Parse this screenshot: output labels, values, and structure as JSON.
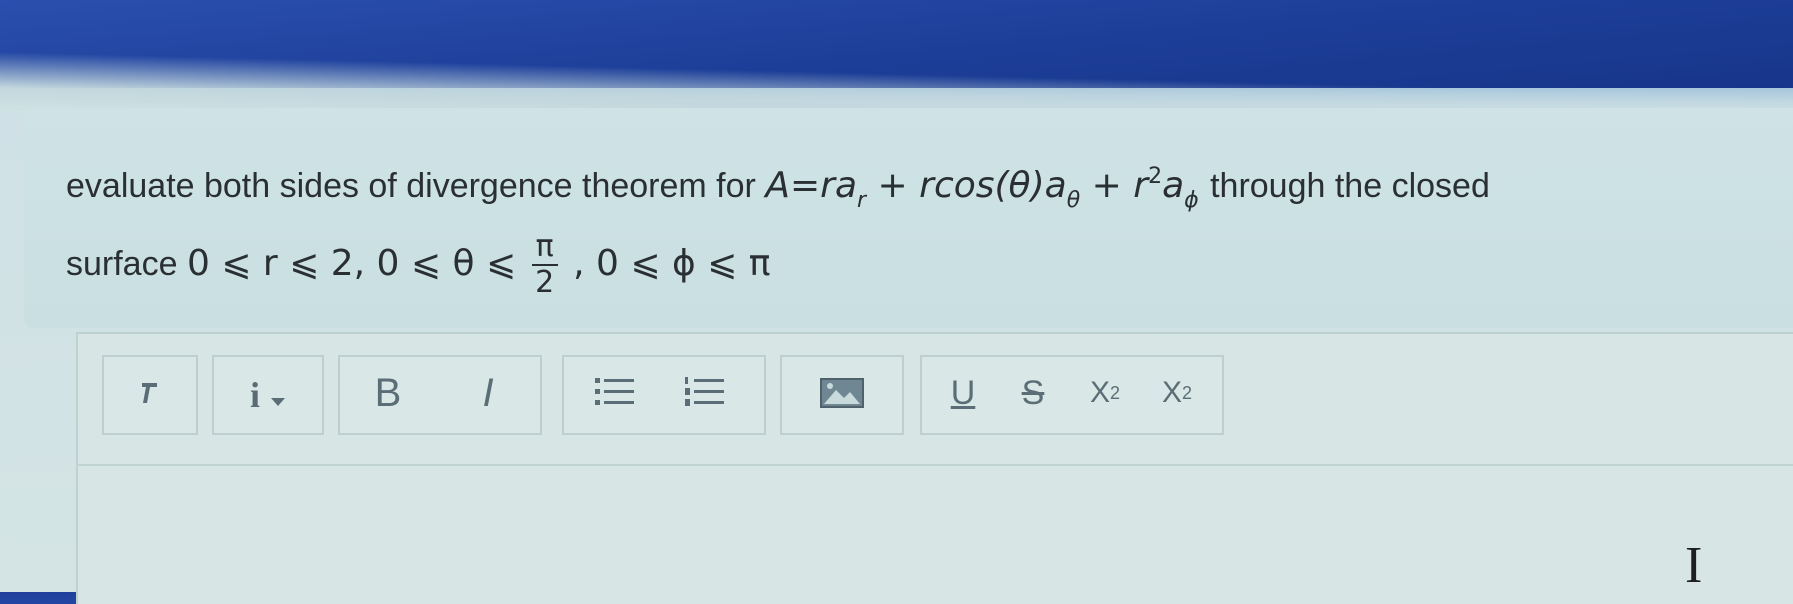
{
  "question": {
    "prefix": "evaluate both sides of divergence theorem for",
    "A": "A",
    "eq": "=",
    "r1": "r",
    "a1": "a",
    "sub_r": "r",
    "plus1": "+",
    "rcos": "rcos(θ)",
    "a2": "a",
    "sub_theta": "θ",
    "plus2": "+",
    "r2": "r",
    "sup2": "2",
    "a3": "a",
    "sub_phi": "ϕ",
    "suffix": "through the closed",
    "line2_prefix": "surface",
    "range1": "0 ⩽ r ⩽ 2, 0 ⩽ θ ⩽",
    "frac_num": "π",
    "frac_den": "2",
    "range2": ", 0 ⩽ ϕ ⩽ π"
  },
  "toolbar": {
    "format_label": "i",
    "bold_label": "B",
    "italic_label": "I",
    "underline_label": "U",
    "strike_label": "S",
    "subscript_base": "X",
    "subscript_mark": "2",
    "superscript_base": "X",
    "superscript_mark": "2",
    "icons": [
      "paragraph-icon",
      "chevron-down-icon",
      "bullet-list-icon",
      "numbered-list-icon",
      "image-icon"
    ]
  },
  "editor": {
    "content": ""
  },
  "colors": {
    "text": "#2a2f33",
    "toolbar_icon": "#5b6d76",
    "panel": "#d7e6e4",
    "header_blue": "#1d3e98"
  }
}
